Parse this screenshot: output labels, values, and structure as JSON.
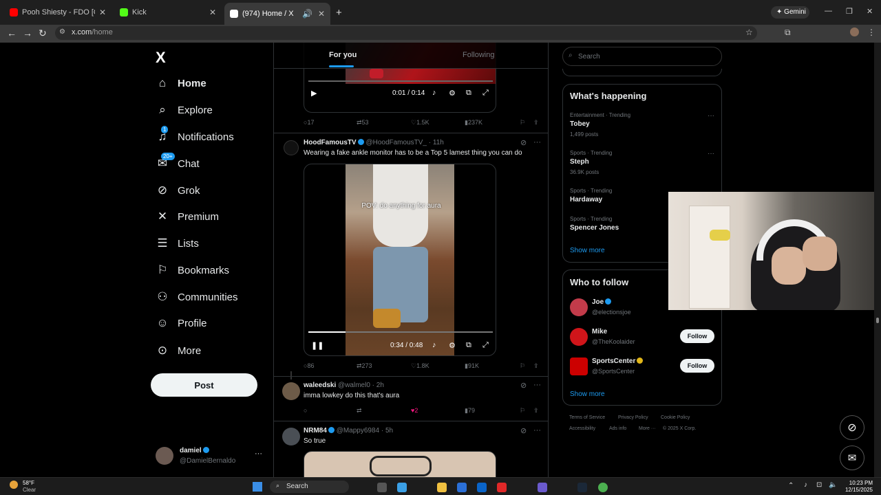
{
  "browser": {
    "tabs": [
      {
        "title": "Pooh Shiesty - FDO [Official M...",
        "favicon_color": "#ff0000"
      },
      {
        "title": "Kick",
        "favicon_color": "#53fc18"
      },
      {
        "title": "(974) Home / X",
        "favicon_color": "#ffffff"
      }
    ],
    "new_tab": "+",
    "gemini_label": "Gemini",
    "url_host": "x.com",
    "url_path": "/home"
  },
  "sidebar": {
    "logo": "X",
    "items": [
      {
        "label": "Home",
        "icon": "home-icon",
        "glyph": "⌂",
        "active": true
      },
      {
        "label": "Explore",
        "icon": "search-icon",
        "glyph": "⌕"
      },
      {
        "label": "Notifications",
        "icon": "bell-icon",
        "glyph": "🔔",
        "badge": "1"
      },
      {
        "label": "Chat",
        "icon": "chat-icon",
        "glyph": "✉",
        "badge": "20+"
      },
      {
        "label": "Grok",
        "icon": "grok-icon",
        "glyph": "⊘"
      },
      {
        "label": "Premium",
        "icon": "x-logo-icon",
        "glyph": "𝕏"
      },
      {
        "label": "Lists",
        "icon": "lists-icon",
        "glyph": "☰"
      },
      {
        "label": "Bookmarks",
        "icon": "bookmark-icon",
        "glyph": "⚑"
      },
      {
        "label": "Communities",
        "icon": "communities-icon",
        "glyph": "👥"
      },
      {
        "label": "Profile",
        "icon": "profile-icon",
        "glyph": "👤"
      },
      {
        "label": "More",
        "icon": "more-circle-icon",
        "glyph": "⊙"
      }
    ],
    "post_button": "Post",
    "account": {
      "name": "damiel",
      "handle": "@DamielBernaldo"
    }
  },
  "feed": {
    "tabs": [
      "For you",
      "Following"
    ],
    "video1": {
      "time": "0:01 / 0:14"
    },
    "tweet1_actions": {
      "replies": "17",
      "reposts": "53",
      "likes": "1.5K",
      "views": "237K"
    },
    "tweet2": {
      "name": "HoodFamousTV",
      "handle": "@HoodFamousTV_",
      "time": "· 11h",
      "text": "Wearing a fake ankle monitor has to be a Top 5 lamest thing you can do",
      "video_caption": "POV:   do anything for aura",
      "video_time": "0:34 / 0:48",
      "progress": 0.2,
      "actions": {
        "replies": "86",
        "reposts": "273",
        "likes": "1.8K",
        "views": "91K"
      }
    },
    "tweet3": {
      "name": "waleedski",
      "handle": "@walmel0",
      "time": "· 2h",
      "text": "imma lowkey do this that's aura",
      "likes": "2",
      "views": "79"
    },
    "tweet4": {
      "name": "NRM84",
      "handle": "@Mappy6984",
      "time": "· 5h",
      "text": "So true"
    }
  },
  "right": {
    "search_placeholder": "Search",
    "whats_happening": "What's happening",
    "trends": [
      {
        "meta": "Entertainment · Trending",
        "name": "Tobey",
        "count": "1,499 posts"
      },
      {
        "meta": "Sports · Trending",
        "name": "Steph",
        "count": "36.9K posts"
      },
      {
        "meta": "Sports · Trending",
        "name": "Hardaway",
        "count": ""
      },
      {
        "meta": "Sports · Trending",
        "name": "Spencer Jones",
        "count": ""
      }
    ],
    "show_more": "Show more",
    "who_to_follow": "Who to follow",
    "follow_suggestions": [
      {
        "name": "Joe",
        "handle": "@electionsjoe",
        "color": "#c23b4a"
      },
      {
        "name": "Mike",
        "handle": "@TheKoolaider",
        "color": "#d0151a"
      },
      {
        "name": "SportsCenter",
        "handle": "@SportsCenter",
        "color": "#cc0000"
      }
    ],
    "follow_label": "Follow",
    "footer": [
      "Terms of Service",
      "Privacy Policy",
      "Cookie Policy",
      "Accessibility",
      "Ads info",
      "More ···",
      "© 2025 X Corp."
    ]
  },
  "taskbar": {
    "temp": "58°F",
    "weather": "Clear",
    "search": "Search",
    "time": "10:23 PM",
    "date": "12/15/2025"
  }
}
